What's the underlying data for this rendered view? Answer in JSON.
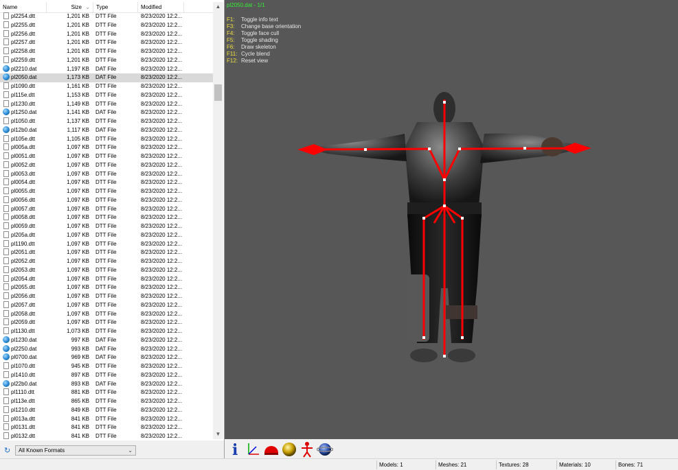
{
  "file_list": {
    "columns": {
      "name": "Name",
      "size": "Size",
      "type": "Type",
      "modified": "Modified"
    },
    "rows": [
      {
        "name": "pl2254.dtt",
        "size": "1,201 KB",
        "type": "DTT File",
        "modified": "8/23/2020 12:2...",
        "icon": "file-icon"
      },
      {
        "name": "pl2255.dtt",
        "size": "1,201 KB",
        "type": "DTT File",
        "modified": "8/23/2020 12:2...",
        "icon": "file-icon"
      },
      {
        "name": "pl2256.dtt",
        "size": "1,201 KB",
        "type": "DTT File",
        "modified": "8/23/2020 12:2...",
        "icon": "file-icon"
      },
      {
        "name": "pl2257.dtt",
        "size": "1,201 KB",
        "type": "DTT File",
        "modified": "8/23/2020 12:2...",
        "icon": "file-icon"
      },
      {
        "name": "pl2258.dtt",
        "size": "1,201 KB",
        "type": "DTT File",
        "modified": "8/23/2020 12:2...",
        "icon": "file-icon"
      },
      {
        "name": "pl2259.dtt",
        "size": "1,201 KB",
        "type": "DTT File",
        "modified": "8/23/2020 12:2...",
        "icon": "file-icon"
      },
      {
        "name": "pl2210.dat",
        "size": "1,197 KB",
        "type": "DAT File",
        "modified": "8/23/2020 12:2...",
        "icon": "dat-icon"
      },
      {
        "name": "pl2050.dat",
        "size": "1,173 KB",
        "type": "DAT File",
        "modified": "8/23/2020 12:2...",
        "icon": "dat-icon",
        "selected": true
      },
      {
        "name": "pl1090.dtt",
        "size": "1,161 KB",
        "type": "DTT File",
        "modified": "8/23/2020 12:2...",
        "icon": "file-icon"
      },
      {
        "name": "pl115e.dtt",
        "size": "1,153 KB",
        "type": "DTT File",
        "modified": "8/23/2020 12:2...",
        "icon": "file-icon"
      },
      {
        "name": "pl1230.dtt",
        "size": "1,149 KB",
        "type": "DTT File",
        "modified": "8/23/2020 12:2...",
        "icon": "file-icon"
      },
      {
        "name": "pl1250.dat",
        "size": "1,141 KB",
        "type": "DAT File",
        "modified": "8/23/2020 12:2...",
        "icon": "dat-icon"
      },
      {
        "name": "pl1050.dtt",
        "size": "1,137 KB",
        "type": "DTT File",
        "modified": "8/23/2020 12:2...",
        "icon": "file-icon"
      },
      {
        "name": "pl12b0.dat",
        "size": "1,117 KB",
        "type": "DAT File",
        "modified": "8/23/2020 12:2...",
        "icon": "dat-icon"
      },
      {
        "name": "pl105e.dtt",
        "size": "1,105 KB",
        "type": "DTT File",
        "modified": "8/23/2020 12:2...",
        "icon": "file-icon"
      },
      {
        "name": "pl005a.dtt",
        "size": "1,097 KB",
        "type": "DTT File",
        "modified": "8/23/2020 12:2...",
        "icon": "file-icon"
      },
      {
        "name": "pl0051.dtt",
        "size": "1,097 KB",
        "type": "DTT File",
        "modified": "8/23/2020 12:2...",
        "icon": "file-icon"
      },
      {
        "name": "pl0052.dtt",
        "size": "1,097 KB",
        "type": "DTT File",
        "modified": "8/23/2020 12:2...",
        "icon": "file-icon"
      },
      {
        "name": "pl0053.dtt",
        "size": "1,097 KB",
        "type": "DTT File",
        "modified": "8/23/2020 12:2...",
        "icon": "file-icon"
      },
      {
        "name": "pl0054.dtt",
        "size": "1,097 KB",
        "type": "DTT File",
        "modified": "8/23/2020 12:2...",
        "icon": "file-icon"
      },
      {
        "name": "pl0055.dtt",
        "size": "1,097 KB",
        "type": "DTT File",
        "modified": "8/23/2020 12:2...",
        "icon": "file-icon"
      },
      {
        "name": "pl0056.dtt",
        "size": "1,097 KB",
        "type": "DTT File",
        "modified": "8/23/2020 12:2...",
        "icon": "file-icon"
      },
      {
        "name": "pl0057.dtt",
        "size": "1,097 KB",
        "type": "DTT File",
        "modified": "8/23/2020 12:2...",
        "icon": "file-icon"
      },
      {
        "name": "pl0058.dtt",
        "size": "1,097 KB",
        "type": "DTT File",
        "modified": "8/23/2020 12:2...",
        "icon": "file-icon"
      },
      {
        "name": "pl0059.dtt",
        "size": "1,097 KB",
        "type": "DTT File",
        "modified": "8/23/2020 12:2...",
        "icon": "file-icon"
      },
      {
        "name": "pl205a.dtt",
        "size": "1,097 KB",
        "type": "DTT File",
        "modified": "8/23/2020 12:2...",
        "icon": "file-icon"
      },
      {
        "name": "pl1190.dtt",
        "size": "1,097 KB",
        "type": "DTT File",
        "modified": "8/23/2020 12:2...",
        "icon": "file-icon"
      },
      {
        "name": "pl2051.dtt",
        "size": "1,097 KB",
        "type": "DTT File",
        "modified": "8/23/2020 12:2...",
        "icon": "file-icon"
      },
      {
        "name": "pl2052.dtt",
        "size": "1,097 KB",
        "type": "DTT File",
        "modified": "8/23/2020 12:2...",
        "icon": "file-icon"
      },
      {
        "name": "pl2053.dtt",
        "size": "1,097 KB",
        "type": "DTT File",
        "modified": "8/23/2020 12:2...",
        "icon": "file-icon"
      },
      {
        "name": "pl2054.dtt",
        "size": "1,097 KB",
        "type": "DTT File",
        "modified": "8/23/2020 12:2...",
        "icon": "file-icon"
      },
      {
        "name": "pl2055.dtt",
        "size": "1,097 KB",
        "type": "DTT File",
        "modified": "8/23/2020 12:2...",
        "icon": "file-icon"
      },
      {
        "name": "pl2056.dtt",
        "size": "1,097 KB",
        "type": "DTT File",
        "modified": "8/23/2020 12:2...",
        "icon": "file-icon"
      },
      {
        "name": "pl2057.dtt",
        "size": "1,097 KB",
        "type": "DTT File",
        "modified": "8/23/2020 12:2...",
        "icon": "file-icon"
      },
      {
        "name": "pl2058.dtt",
        "size": "1,097 KB",
        "type": "DTT File",
        "modified": "8/23/2020 12:2...",
        "icon": "file-icon"
      },
      {
        "name": "pl2059.dtt",
        "size": "1,097 KB",
        "type": "DTT File",
        "modified": "8/23/2020 12:2...",
        "icon": "file-icon"
      },
      {
        "name": "pl1130.dtt",
        "size": "1,073 KB",
        "type": "DTT File",
        "modified": "8/23/2020 12:2...",
        "icon": "file-icon"
      },
      {
        "name": "pl1230.dat",
        "size": "997 KB",
        "type": "DAT File",
        "modified": "8/23/2020 12:2...",
        "icon": "dat-icon"
      },
      {
        "name": "pl2250.dat",
        "size": "993 KB",
        "type": "DAT File",
        "modified": "8/23/2020 12:2...",
        "icon": "dat-icon"
      },
      {
        "name": "pl0700.dat",
        "size": "969 KB",
        "type": "DAT File",
        "modified": "8/23/2020 12:2...",
        "icon": "dat-icon"
      },
      {
        "name": "pl1070.dtt",
        "size": "945 KB",
        "type": "DTT File",
        "modified": "8/23/2020 12:2...",
        "icon": "file-icon"
      },
      {
        "name": "pl1410.dtt",
        "size": "897 KB",
        "type": "DTT File",
        "modified": "8/23/2020 12:2...",
        "icon": "file-icon"
      },
      {
        "name": "pl22b0.dat",
        "size": "893 KB",
        "type": "DAT File",
        "modified": "8/23/2020 12:2...",
        "icon": "dat-icon"
      },
      {
        "name": "pl1110.dtt",
        "size": "881 KB",
        "type": "DTT File",
        "modified": "8/23/2020 12:2...",
        "icon": "file-icon"
      },
      {
        "name": "pl113e.dtt",
        "size": "865 KB",
        "type": "DTT File",
        "modified": "8/23/2020 12:2...",
        "icon": "file-icon"
      },
      {
        "name": "pl1210.dtt",
        "size": "849 KB",
        "type": "DTT File",
        "modified": "8/23/2020 12:2...",
        "icon": "file-icon"
      },
      {
        "name": "pl013a.dtt",
        "size": "841 KB",
        "type": "DTT File",
        "modified": "8/23/2020 12:2...",
        "icon": "file-icon"
      },
      {
        "name": "pl0131.dtt",
        "size": "841 KB",
        "type": "DTT File",
        "modified": "8/23/2020 12:2...",
        "icon": "file-icon"
      },
      {
        "name": "pl0132.dtt",
        "size": "841 KB",
        "type": "DTT File",
        "modified": "8/23/2020 12:2...",
        "icon": "file-icon"
      }
    ]
  },
  "filter": {
    "value": "All Known Formats",
    "refresh_icon": "refresh-icon",
    "dropdown_icon": "chevron-down-icon"
  },
  "viewport": {
    "title": "pl2050.dat - 1/1",
    "help": [
      {
        "key": "F1:",
        "desc": "Toggle info text"
      },
      {
        "key": "F3:",
        "desc": "Change base orientation"
      },
      {
        "key": "F4:",
        "desc": "Toggle face cull"
      },
      {
        "key": "F5:",
        "desc": "Toggle shading"
      },
      {
        "key": "F6:",
        "desc": "Draw skeleton"
      },
      {
        "key": "F11:",
        "desc": "Cycle blend"
      },
      {
        "key": "F12:",
        "desc": "Reset view"
      }
    ],
    "colors": {
      "background": "#575757",
      "title": "#36ee36",
      "key": "#f0e040",
      "skeleton": "#ff0000"
    }
  },
  "toolbar": {
    "buttons": [
      "info-icon",
      "axes-icon",
      "dome-icon",
      "sphere-icon",
      "skeleton-icon",
      "planet-icon"
    ]
  },
  "status": {
    "models": "Models: 1",
    "meshes": "Meshes: 21",
    "textures": "Textures: 28",
    "materials": "Materials: 10",
    "bones": "Bones: 71"
  }
}
